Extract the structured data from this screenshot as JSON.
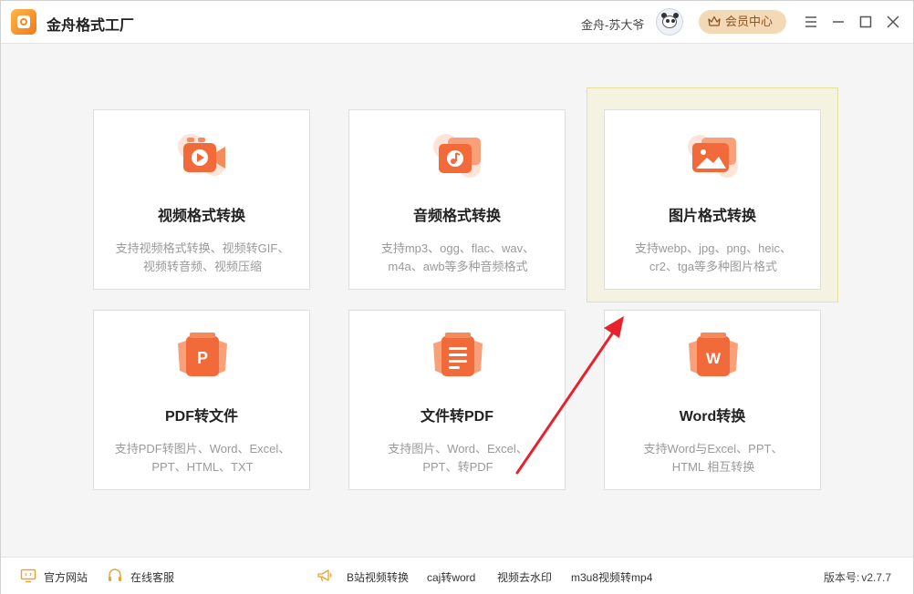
{
  "window": {
    "title": "金舟格式工厂"
  },
  "header": {
    "user_name": "金舟-苏大爷",
    "vip_label": "会员中心"
  },
  "colors": {
    "accent": "#f05a24",
    "vip_bg": "#f3d9b6",
    "vip_text": "#8a5523",
    "arrow": "#e8222d"
  },
  "cards": [
    {
      "title": "视频格式转换",
      "desc1": "支持视频格式转换、视频转GIF、",
      "desc2": "视频转音频、视频压缩",
      "icon": "video-icon"
    },
    {
      "title": "音频格式转换",
      "desc1": "支持mp3、ogg、flac、wav、",
      "desc2": "m4a、awb等多种音频格式",
      "icon": "audio-icon"
    },
    {
      "title": "图片格式转换",
      "desc1": "支持webp、jpg、png、heic、",
      "desc2": "cr2、tga等多种图片格式",
      "icon": "image-icon"
    },
    {
      "title": "PDF转文件",
      "desc1": "支持PDF转图片、Word、Excel、",
      "desc2": "PPT、HTML、TXT",
      "icon": "pdf-icon"
    },
    {
      "title": "文件转PDF",
      "desc1": "支持图片、Word、Excel、",
      "desc2": "PPT、转PDF",
      "icon": "document-icon"
    },
    {
      "title": "Word转换",
      "desc1": "支持Word与Excel、PPT、",
      "desc2": "HTML 相互转换",
      "icon": "word-icon"
    }
  ],
  "footer": {
    "website": "官方网站",
    "support": "在线客服",
    "bilibili": "B站视频转换",
    "caj": "caj转word",
    "watermark": "视频去水印",
    "m3u8": "m3u8视频转mp4",
    "version_label": "版本号:",
    "version_value": "v2.7.7"
  }
}
